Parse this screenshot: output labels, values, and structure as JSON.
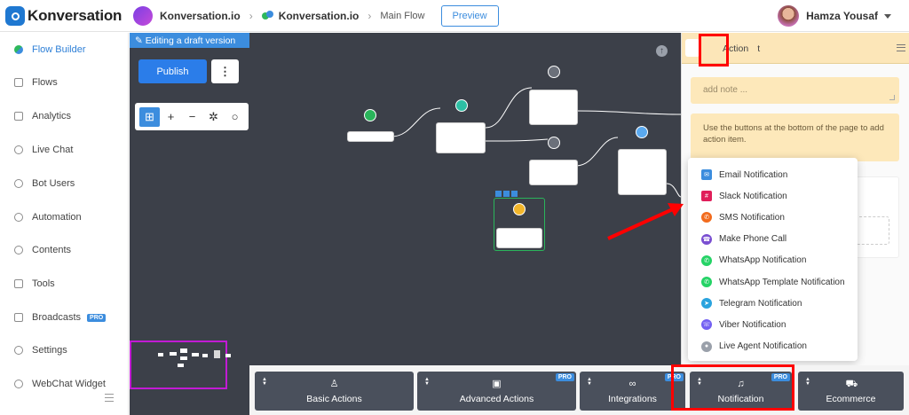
{
  "header": {
    "app_name": "Konversation",
    "project": "Konversation.io",
    "flow_project": "Konversation.io",
    "flow_name": "Main Flow",
    "preview_label": "Preview",
    "user_name": "Hamza Yousaf"
  },
  "sidebar": {
    "items": [
      {
        "label": "Flow Builder",
        "icon": "flow-builder-icon"
      },
      {
        "label": "Flows",
        "icon": "flows-icon"
      },
      {
        "label": "Analytics",
        "icon": "analytics-icon"
      },
      {
        "label": "Live Chat",
        "icon": "headset-icon"
      },
      {
        "label": "Bot Users",
        "icon": "user-icon"
      },
      {
        "label": "Automation",
        "icon": "automation-icon"
      },
      {
        "label": "Contents",
        "icon": "contents-icon"
      },
      {
        "label": "Tools",
        "icon": "tools-icon"
      },
      {
        "label": "Broadcasts",
        "icon": "megaphone-icon",
        "badge": "PRO"
      },
      {
        "label": "Settings",
        "icon": "gear-icon"
      },
      {
        "label": "WebChat Widget",
        "icon": "chat-icon"
      }
    ]
  },
  "editor": {
    "draft_label": "Editing a draft version",
    "publish_label": "Publish",
    "more_label": "⋮"
  },
  "right_panel": {
    "title": "Action",
    "title_tail": "t",
    "note_placeholder": "add note ...",
    "info_text": "Use the buttons at the bottom of the page to add action item."
  },
  "notification_menu": {
    "items": [
      {
        "label": "Email Notification",
        "icon": "email-icon",
        "color": "#3c8dde"
      },
      {
        "label": "Slack Notification",
        "icon": "slack-icon",
        "color": "#e01e5a"
      },
      {
        "label": "SMS Notification",
        "icon": "sms-icon",
        "color": "#f26b1d"
      },
      {
        "label": "Make Phone Call",
        "icon": "phone-icon",
        "color": "#7a4fd1"
      },
      {
        "label": "WhatsApp Notification",
        "icon": "whatsapp-icon",
        "color": "#25d366"
      },
      {
        "label": "WhatsApp Template Notification",
        "icon": "whatsapp-icon",
        "color": "#25d366"
      },
      {
        "label": "Telegram Notification",
        "icon": "telegram-icon",
        "color": "#2aa3de"
      },
      {
        "label": "Viber Notification",
        "icon": "viber-icon",
        "color": "#7360f2"
      },
      {
        "label": "Live Agent Notification",
        "icon": "agent-icon",
        "color": "#9aa0aa"
      }
    ]
  },
  "bottom_bar": {
    "buttons": [
      {
        "label": "Basic Actions",
        "icon": "user-icon"
      },
      {
        "label": "Advanced Actions",
        "icon": "briefcase-icon",
        "badge": "PRO"
      },
      {
        "label": "Integrations",
        "icon": "link-icon",
        "badge": "PRO"
      },
      {
        "label": "Notification",
        "icon": "bell-icon",
        "badge": "PRO"
      },
      {
        "label": "Ecommerce",
        "icon": "cart-icon"
      }
    ]
  },
  "colors": {
    "accent": "#3c8dde",
    "canvas": "#3c4049",
    "highlight": "#ff0000",
    "panel_header": "#fce6b8"
  }
}
